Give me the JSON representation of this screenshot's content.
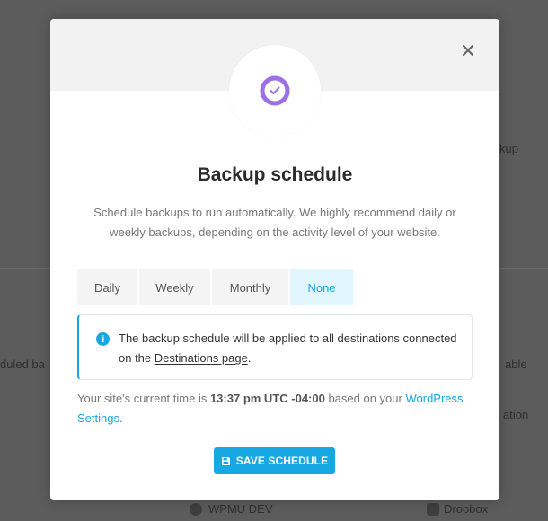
{
  "background": {
    "items": [
      "kup",
      "duled ba",
      "able",
      "ation",
      "WPMU DEV",
      "Dropbox"
    ]
  },
  "modal": {
    "title": "Backup schedule",
    "description": "Schedule backups to run automatically. We highly recommend daily or weekly backups, depending on the activity level of your website.",
    "close_icon": "close-icon",
    "hero_icon": "clock-icon",
    "tabs": [
      {
        "label": "Daily",
        "selected": false
      },
      {
        "label": "Weekly",
        "selected": false
      },
      {
        "label": "Monthly",
        "selected": false
      },
      {
        "label": "None",
        "selected": true
      }
    ],
    "notice": {
      "icon": "info-icon",
      "text_prefix": "The backup schedule will be applied to all destinations connected on the ",
      "link_text": "Destinations page",
      "text_suffix": "."
    },
    "site_time": {
      "prefix": "Your site's current time is ",
      "time": "13:37 pm UTC -04:00",
      "middle": " based on your ",
      "link_text": "WordPress Settings",
      "suffix": "."
    },
    "save_button": {
      "label": "SAVE SCHEDULE",
      "icon": "save-icon"
    }
  },
  "colors": {
    "accent": "#17a8e3",
    "active_tab_bg": "#e1f6ff",
    "hero_ring": "#9c6fe4",
    "overlay": "#5c5c5c"
  }
}
